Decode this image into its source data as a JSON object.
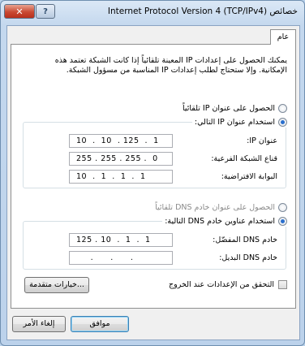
{
  "window": {
    "title": "خصائص Internet Protocol Version 4 (TCP/IPv4)",
    "close_glyph": "✕",
    "help_glyph": "?"
  },
  "tabs": [
    {
      "label": "عام"
    }
  ],
  "general": {
    "intro_line1": "يمكنك الحصول على إعدادات IP المعينة تلقائياً إذا كانت الشبكة تعتمد هذه",
    "intro_line2": "الإمكانية. وإلا ستحتاج لطلب إعدادات IP المناسبة من مسؤول الشبكة.",
    "ip_auto_label": "الحصول على عنوان IP تلقائياً",
    "ip_manual_label": "استخدام عنوان IP التالي:",
    "ip_address_label": "عنوان IP:",
    "ip_address_value": "10  .  10  . 125  .  1",
    "subnet_label": "قناع الشبكة الفرعية:",
    "subnet_value": "255 . 255 . 255 .  0",
    "gateway_label": "البوابة الافتراضية:",
    "gateway_value": "10  .  1  .  1  .  1",
    "dns_auto_label": "الحصول على عنوان خادم DNS تلقائياً",
    "dns_manual_label": "استخدام عناوين خادم DNS التالية:",
    "preferred_dns_label": "خادم DNS المفضّل:",
    "preferred_dns_value": "125 . 10  .  1  .  1",
    "alternate_dns_label": "خادم DNS البديل:",
    "alternate_dns_value": "     .      .      .",
    "validate_label": "التحقق من الإعدادات عند الخروج",
    "advanced_label": "خيارات متقدمة..."
  },
  "footer": {
    "ok_label": "موافق",
    "cancel_label": "إلغاء الأمر"
  }
}
